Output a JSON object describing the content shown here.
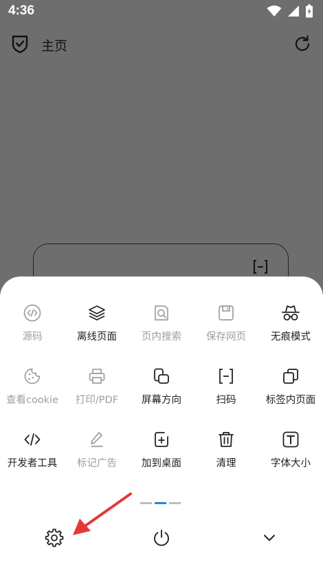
{
  "status": {
    "time": "4:36"
  },
  "appbar": {
    "title": "主页"
  },
  "menu": {
    "items": [
      {
        "label": "源码",
        "icon": "code-icon",
        "enabled": false
      },
      {
        "label": "离线页面",
        "icon": "layers-icon",
        "enabled": true
      },
      {
        "label": "页内搜索",
        "icon": "find-in-page-icon",
        "enabled": false
      },
      {
        "label": "保存网页",
        "icon": "save-icon",
        "enabled": false
      },
      {
        "label": "无痕模式",
        "icon": "incognito-icon",
        "enabled": true
      },
      {
        "label": "查看cookie",
        "icon": "cookie-icon",
        "enabled": false
      },
      {
        "label": "打印/PDF",
        "icon": "printer-icon",
        "enabled": false
      },
      {
        "label": "屏幕方向",
        "icon": "screen-rotate-icon",
        "enabled": true
      },
      {
        "label": "扫码",
        "icon": "scan-icon",
        "enabled": true
      },
      {
        "label": "标签内页面",
        "icon": "copy-icon",
        "enabled": true
      },
      {
        "label": "开发者工具",
        "icon": "code-icon",
        "enabled": true
      },
      {
        "label": "标记广告",
        "icon": "pen-icon",
        "enabled": false
      },
      {
        "label": "加到桌面",
        "icon": "add-to-desktop-icon",
        "enabled": true
      },
      {
        "label": "清理",
        "icon": "trash-icon",
        "enabled": true
      },
      {
        "label": "字体大小",
        "icon": "font-size-icon",
        "enabled": true
      }
    ],
    "page_index": 1,
    "page_count": 3
  },
  "colors": {
    "accent": "#1e88e5",
    "scrim": "#6e6e6e",
    "annotation": "#e53935"
  }
}
